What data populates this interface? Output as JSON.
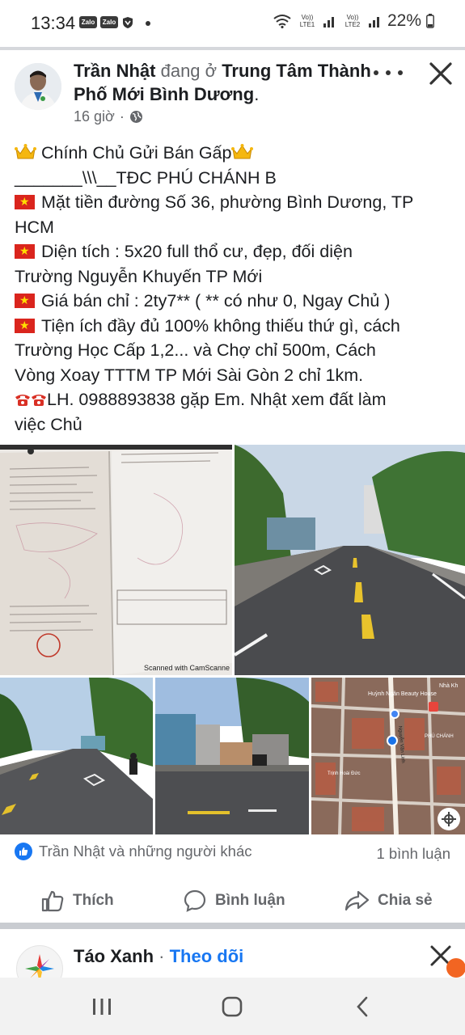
{
  "status_bar": {
    "time": "13:34",
    "app_badges": [
      "Zalo",
      "Zalo"
    ],
    "sim1": "Vo)) LTE1",
    "sim2": "Vo)) LTE2",
    "battery": "22%"
  },
  "post": {
    "author": "Trần Nhật",
    "location_prefix": "đang ở",
    "location": "Trung Tâm Thành Phố Mới Bình Dương",
    "location_suffix": ".",
    "time": "16 giờ",
    "separator": "·",
    "text_lines": [
      "Chính Chủ Gửi Bán Gấp",
      "_______\\\\\\__TĐC PHÚ CHÁNH B",
      "Mặt tiền đường Số 36, phường Bình Dương, TP",
      "HCM",
      "Diện tích : 5x20 full thổ cư, đẹp, đối diện",
      "Trường Nguyễn Khuyến TP Mới",
      "Giá bán chỉ : 2ty7** ( ** có như 0, Ngay Chủ )",
      "Tiện ích đầy đủ 100% không thiếu thứ gì, cách",
      "Trường Học Cấp 1,2... và Chợ chỉ 500m, Cách",
      "Vòng Xoay TTTM TP Mới Sài Gòn 2 chỉ 1km.",
      "LH. 0988893838 gặp Em. Nhật xem đất làm",
      "việc Chủ"
    ],
    "photo_caption": "Scanned with CamScanne",
    "map_labels": [
      "Huỳnh Ngân Beauty House",
      "Nguyễn Văn Linh",
      "Trịnh Hoài Đức",
      "PHÚ CHÁNH",
      "Nhà Kh"
    ],
    "reactions_text": "Trần Nhật và những người khác",
    "comments_count": "1 bình luận",
    "actions": {
      "like": "Thích",
      "comment": "Bình luận",
      "share": "Chia sẻ"
    }
  },
  "next_post": {
    "author": "Táo Xanh",
    "separator": "·",
    "follow": "Theo dõi"
  },
  "colors": {
    "facebook_blue": "#1877f2",
    "secondary_text": "#65676b",
    "flag_red": "#da251d"
  }
}
